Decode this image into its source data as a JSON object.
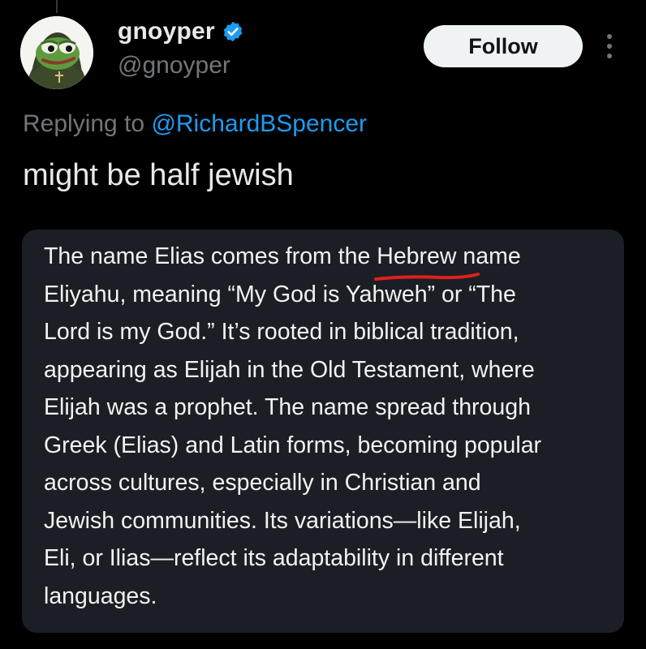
{
  "user": {
    "display_name": "gnoyper",
    "handle": "@gnoyper",
    "verified": true,
    "verified_color": "#1d9bf0"
  },
  "actions": {
    "follow_label": "Follow",
    "more_icon": "more-vertical-icon"
  },
  "reply": {
    "prefix": "Replying to",
    "mention": "@RichardBSpencer"
  },
  "tweet": {
    "text": "might be half jewish"
  },
  "quoted_text": {
    "line1_before": "The name Elias comes from the ",
    "line1_highlight": "Hebrew",
    "line1_after": " name",
    "line2": "Eliyahu, meaning “My God is Yahweh” or “The",
    "line3": "Lord is my God.” It’s rooted in biblical tradition,",
    "line4": "appearing as Elijah in the Old Testament, where",
    "line5": "Elijah was a prophet. The name spread through",
    "line6": "Greek (Elias) and Latin forms, becoming popular",
    "line7": "across cultures, especially in Christian and",
    "line8": "Jewish communities. Its variations—like Elijah,",
    "line9": "Eli, or Ilias—reflect its adaptability in different",
    "line10": "languages.",
    "highlight_color": "#e0201c"
  },
  "colors": {
    "background": "#000000",
    "card": "#1b1f25",
    "secondary_text": "#71767b",
    "link": "#1d9bf0"
  }
}
